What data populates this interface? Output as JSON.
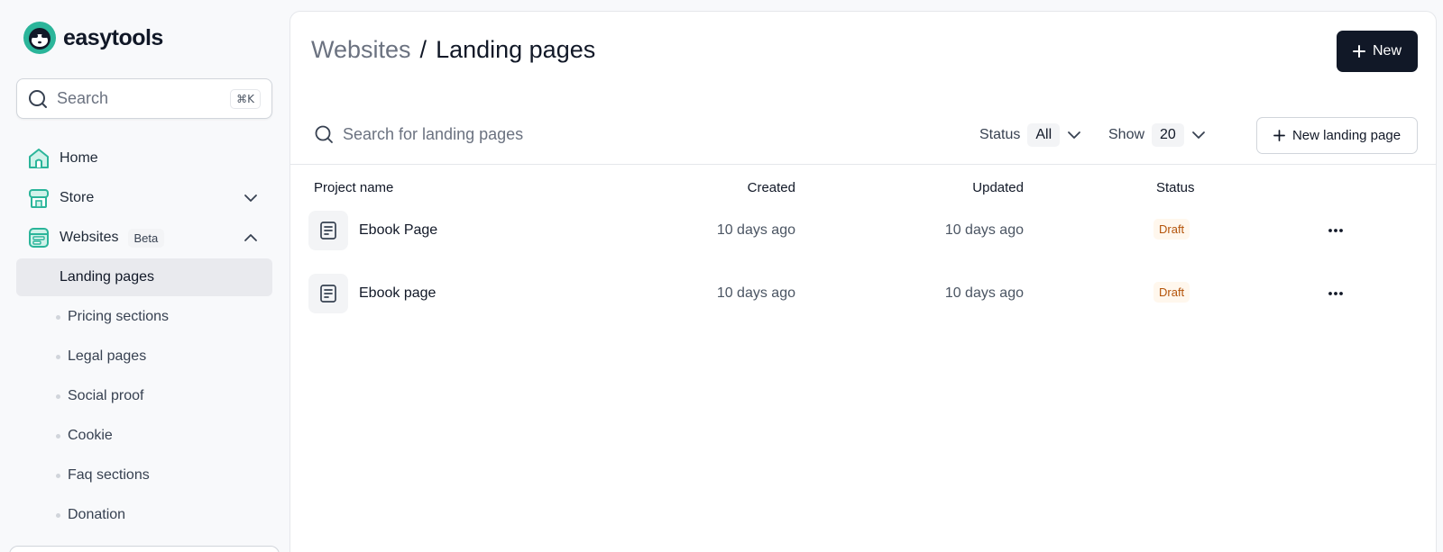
{
  "brand": {
    "name": "easytools"
  },
  "sidebar": {
    "search": {
      "placeholder": "Search",
      "shortcut": "⌘K"
    },
    "items": [
      {
        "label": "Home",
        "icon": "home-icon"
      },
      {
        "label": "Store",
        "icon": "store-icon"
      },
      {
        "label": "Websites",
        "icon": "websites-icon",
        "badge": "Beta"
      }
    ],
    "subitems": [
      {
        "label": "Landing pages",
        "active": true
      },
      {
        "label": "Pricing sections"
      },
      {
        "label": "Legal pages"
      },
      {
        "label": "Social proof"
      },
      {
        "label": "Cookie"
      },
      {
        "label": "Faq sections"
      },
      {
        "label": "Donation"
      }
    ]
  },
  "header": {
    "breadcrumb_parent": "Websites",
    "breadcrumb_separator": "/",
    "breadcrumb_current": "Landing pages",
    "new_button": "New"
  },
  "filters": {
    "search_placeholder": "Search for landing pages",
    "status_label": "Status",
    "status_value": "All",
    "show_label": "Show",
    "show_value": "20",
    "new_landing_page_button": "New landing page"
  },
  "table": {
    "columns": [
      "Project name",
      "Created",
      "Updated",
      "Status"
    ],
    "rows": [
      {
        "name": "Ebook Page",
        "created": "10 days ago",
        "updated": "10 days ago",
        "status": "Draft"
      },
      {
        "name": "Ebook page",
        "created": "10 days ago",
        "updated": "10 days ago",
        "status": "Draft"
      }
    ]
  },
  "colors": {
    "accent": "#2bb59a",
    "primary_button": "#111827",
    "draft_text": "#b45309",
    "draft_bg": "#fff7ed"
  }
}
